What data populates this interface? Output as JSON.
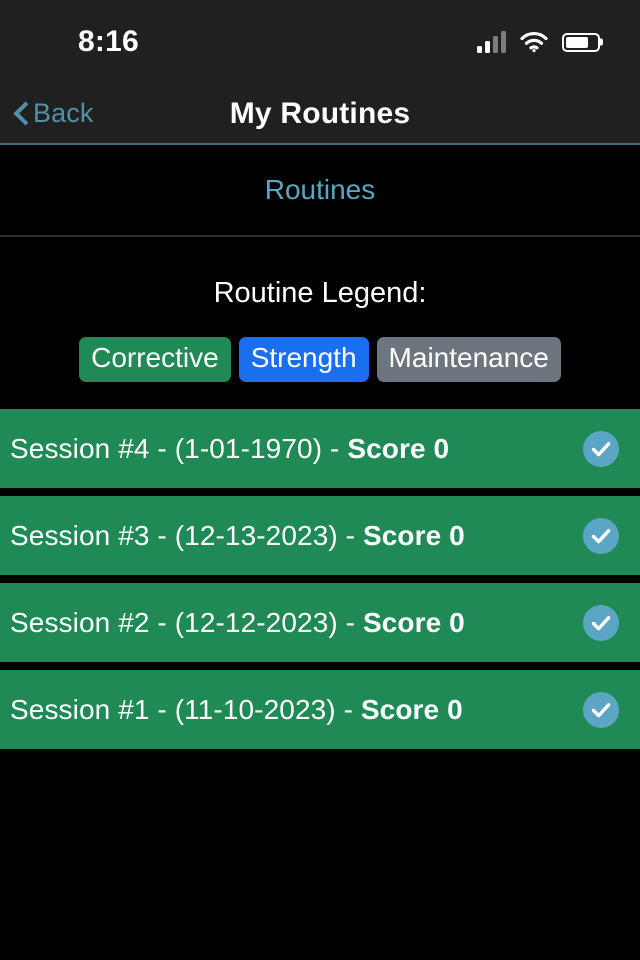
{
  "status_bar": {
    "time": "8:16",
    "signal_icon": "cellular-signal-icon",
    "signal_bars_filled": 2,
    "signal_bars_total": 4,
    "wifi_icon": "wifi-icon",
    "battery_icon": "battery-icon",
    "battery_level_percent": 72
  },
  "nav_bar": {
    "back_icon": "chevron-left-icon",
    "back_label": "Back",
    "title": "My Routines",
    "accent_color": "#4f92a8",
    "background_color": "#202020"
  },
  "tabs": [
    {
      "label": "Routines",
      "selected": true
    }
  ],
  "legend": {
    "title": "Routine Legend:",
    "badges": [
      {
        "label": "Corrective",
        "color": "#1f8a55"
      },
      {
        "label": "Strength",
        "color": "#1a6fee"
      },
      {
        "label": "Maintenance",
        "color": "#6d767f"
      }
    ]
  },
  "sessions": [
    {
      "title": "Session #4 - (1-01-1970) - ",
      "score_text": "Score 0",
      "name": "Session #4",
      "date": "1-01-1970",
      "score": 0,
      "type_color": "#1f8a55",
      "status_icon": "check-circle-icon",
      "completed": true
    },
    {
      "title": "Session #3 - (12-13-2023) - ",
      "score_text": "Score 0",
      "name": "Session #3",
      "date": "12-13-2023",
      "score": 0,
      "type_color": "#1f8a55",
      "status_icon": "check-circle-icon",
      "completed": true
    },
    {
      "title": "Session #2 - (12-12-2023) - ",
      "score_text": "Score 0",
      "name": "Session #2",
      "date": "12-12-2023",
      "score": 0,
      "type_color": "#1f8a55",
      "status_icon": "check-circle-icon",
      "completed": true
    },
    {
      "title": "Session #1 - (11-10-2023) - ",
      "score_text": "Score 0",
      "name": "Session #1",
      "date": "11-10-2023",
      "score": 0,
      "type_color": "#1f8a55",
      "status_icon": "check-circle-icon",
      "completed": true
    }
  ]
}
